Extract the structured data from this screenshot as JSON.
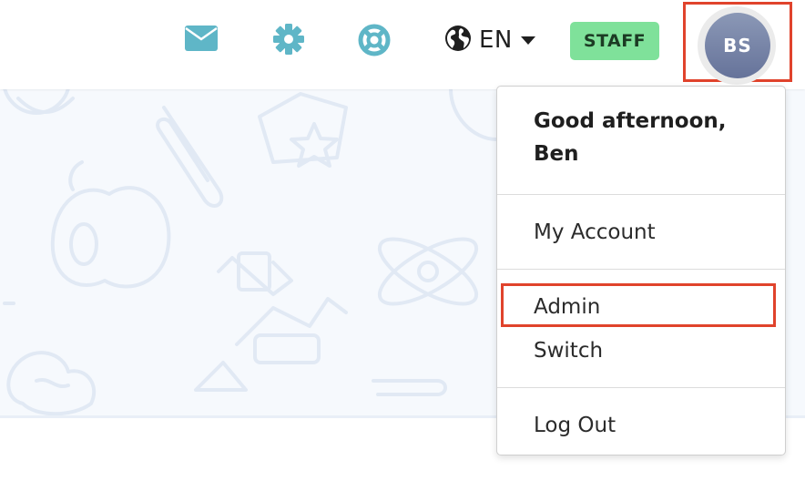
{
  "topbar": {
    "icons": [
      "mail-icon",
      "gear-icon",
      "lifebuoy-icon",
      "globe-icon",
      "caret-down-icon"
    ],
    "language": "EN",
    "staff_badge": "STAFF",
    "avatar_initials": "BS"
  },
  "menu": {
    "greeting": "Good afternoon, Ben",
    "items": [
      "My Account",
      "Admin",
      "Switch",
      "Log Out"
    ]
  },
  "colors": {
    "icon_teal": "#5fb6c7",
    "staff_green": "#7fe19a",
    "highlight_red": "#e0432c",
    "avatar_gradient_top": "#8b98b6",
    "avatar_gradient_bottom": "#66739a"
  }
}
